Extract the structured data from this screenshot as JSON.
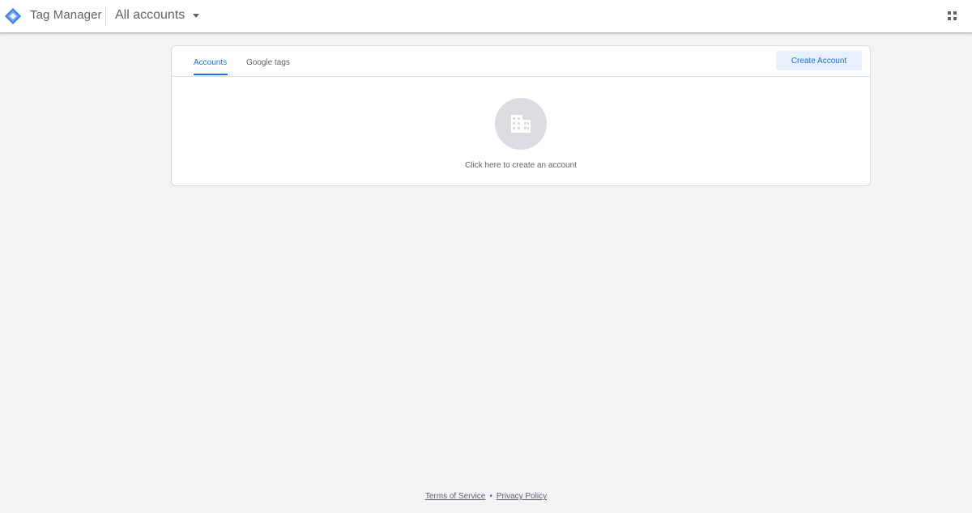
{
  "header": {
    "app_name": "Tag Manager",
    "account_picker_label": "All accounts"
  },
  "card": {
    "tabs": [
      {
        "label": "Accounts",
        "active": true
      },
      {
        "label": "Google tags",
        "active": false
      }
    ],
    "create_button_label": "Create Account",
    "empty_state_text": "Click here to create an account"
  },
  "footer": {
    "terms_label": "Terms of Service",
    "separator": "•",
    "privacy_label": "Privacy Policy"
  },
  "colors": {
    "accent": "#1a73e8",
    "background": "#f1f3f4"
  },
  "icons": [
    "tag-manager-logo-icon",
    "chevron-down-icon",
    "apps-grid-icon",
    "building-icon"
  ]
}
